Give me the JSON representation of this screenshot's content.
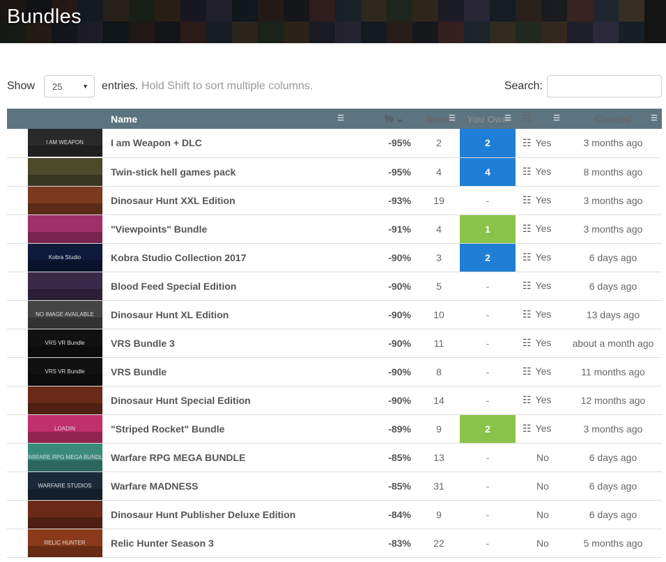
{
  "page": {
    "title": "Bundles"
  },
  "controls": {
    "show_label": "Show",
    "page_size": "25",
    "entries_label": "entries.",
    "hint": "Hold Shift to sort multiple columns.",
    "search_label": "Search:",
    "search_value": ""
  },
  "table": {
    "headers": {
      "name": "Name",
      "pct": "%",
      "items": "Items",
      "you_own": "You Own",
      "created": "Created"
    },
    "rows": [
      {
        "name": "I am Weapon + DLC",
        "pct": "-95%",
        "items": "2",
        "own": "2",
        "own_style": "blue",
        "wishlist": "Yes",
        "created": "3 months ago",
        "thumb_color": "#2a2a2a",
        "thumb_caption": "I AM WEAPON"
      },
      {
        "name": "Twin-stick hell games pack",
        "pct": "-95%",
        "items": "4",
        "own": "4",
        "own_style": "blue",
        "wishlist": "Yes",
        "created": "8 months ago",
        "thumb_color": "#4b4a2a",
        "thumb_caption": ""
      },
      {
        "name": "Dinosaur Hunt XXL Edition",
        "pct": "-93%",
        "items": "19",
        "own": "-",
        "own_style": "none",
        "wishlist": "Yes",
        "created": "3 months ago",
        "thumb_color": "#7a3a1f",
        "thumb_caption": ""
      },
      {
        "name": "\"Viewpoints\" Bundle",
        "pct": "-91%",
        "items": "4",
        "own": "1",
        "own_style": "green",
        "wishlist": "Yes",
        "created": "3 months ago",
        "thumb_color": "#a0306a",
        "thumb_caption": ""
      },
      {
        "name": "Kobra Studio Collection 2017",
        "pct": "-90%",
        "items": "3",
        "own": "2",
        "own_style": "blue",
        "wishlist": "Yes",
        "created": "6 days ago",
        "thumb_color": "#0d1a3a",
        "thumb_caption": "Kobra Studio"
      },
      {
        "name": "Blood Feed Special Edition",
        "pct": "-90%",
        "items": "5",
        "own": "-",
        "own_style": "none",
        "wishlist": "Yes",
        "created": "6 days ago",
        "thumb_color": "#3a2a4a",
        "thumb_caption": ""
      },
      {
        "name": "Dinosaur Hunt XL Edition",
        "pct": "-90%",
        "items": "10",
        "own": "-",
        "own_style": "none",
        "wishlist": "Yes",
        "created": "13 days ago",
        "thumb_color": "#444444",
        "thumb_caption": "NO IMAGE AVAILABLE"
      },
      {
        "name": "VRS Bundle 3",
        "pct": "-90%",
        "items": "11",
        "own": "-",
        "own_style": "none",
        "wishlist": "Yes",
        "created": "about a month ago",
        "thumb_color": "#111111",
        "thumb_caption": "VRS VR Bundle"
      },
      {
        "name": "VRS Bundle",
        "pct": "-90%",
        "items": "8",
        "own": "-",
        "own_style": "none",
        "wishlist": "Yes",
        "created": "11 months ago",
        "thumb_color": "#111111",
        "thumb_caption": "VRS VR Bundle"
      },
      {
        "name": "Dinosaur Hunt Special Edition",
        "pct": "-90%",
        "items": "14",
        "own": "-",
        "own_style": "none",
        "wishlist": "Yes",
        "created": "12 months ago",
        "thumb_color": "#6a2a1a",
        "thumb_caption": ""
      },
      {
        "name": "\"Striped Rocket\" Bundle",
        "pct": "-89%",
        "items": "9",
        "own": "2",
        "own_style": "green",
        "wishlist": "Yes",
        "created": "3 months ago",
        "thumb_color": "#c0306a",
        "thumb_caption": "LOADIN"
      },
      {
        "name": "Warfare RPG MEGA BUNDLE",
        "pct": "-85%",
        "items": "13",
        "own": "-",
        "own_style": "none",
        "wishlist": "No",
        "created": "6 days ago",
        "thumb_color": "#3a8a7a",
        "thumb_caption": "WARFARE RPG MEGA BUNDLE"
      },
      {
        "name": "Warfare MADNESS",
        "pct": "-85%",
        "items": "31",
        "own": "-",
        "own_style": "none",
        "wishlist": "No",
        "created": "6 days ago",
        "thumb_color": "#1a2a3a",
        "thumb_caption": "WARFARE STUDIOS"
      },
      {
        "name": "Dinosaur Hunt Publisher Deluxe Edition",
        "pct": "-84%",
        "items": "9",
        "own": "-",
        "own_style": "none",
        "wishlist": "No",
        "created": "6 days ago",
        "thumb_color": "#6a2a1a",
        "thumb_caption": ""
      },
      {
        "name": "Relic Hunter Season 3",
        "pct": "-83%",
        "items": "22",
        "own": "-",
        "own_style": "none",
        "wishlist": "No",
        "created": "5 months ago",
        "thumb_color": "#8a3a1a",
        "thumb_caption": "RELIC HUNTER"
      }
    ]
  },
  "colors": {
    "header_bg": "#5b7480",
    "own_blue": "#1f7fd6",
    "own_green": "#8bc34a"
  }
}
